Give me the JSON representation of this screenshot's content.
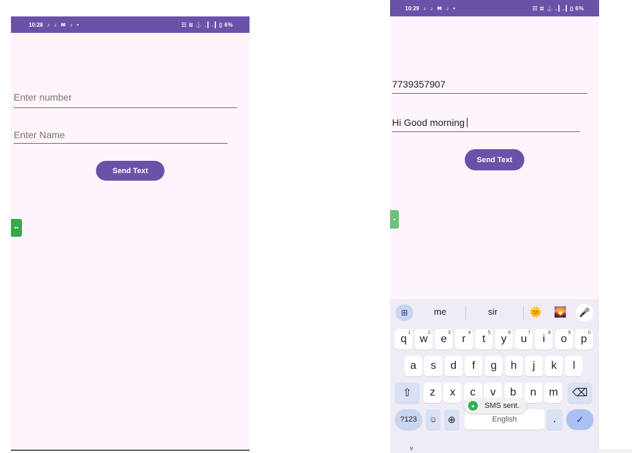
{
  "left_screen": {
    "status_time": "10:28",
    "status_icons": "♪ ♪ ✉ ♪ •",
    "status_right": "☷ ≣ ⚓ .┃ .┃ ▯ 6%",
    "number_placeholder": "Enter number",
    "name_placeholder": "Enter Name",
    "send_button": "Send Text",
    "tab_glyph": "••"
  },
  "right_screen": {
    "status_time": "10:29",
    "status_icons": "♪ ♪ ✉ ♪ •",
    "status_right": "☷ ≣ ⚓ .┃ .┃ ▯ 6%",
    "number_value": "7739357907",
    "message_value": "Hi Good morning",
    "send_button": "Send Text",
    "tab_glyph": "•"
  },
  "keyboard": {
    "suggestions": [
      "me",
      "sir"
    ],
    "emoji_1": "🌞",
    "emoji_2": "🌄",
    "row1": [
      {
        "k": "q",
        "n": "1"
      },
      {
        "k": "w",
        "n": "2"
      },
      {
        "k": "e",
        "n": "3"
      },
      {
        "k": "r",
        "n": "4"
      },
      {
        "k": "t",
        "n": "5"
      },
      {
        "k": "y",
        "n": "6"
      },
      {
        "k": "u",
        "n": "7"
      },
      {
        "k": "i",
        "n": "8"
      },
      {
        "k": "o",
        "n": "9"
      },
      {
        "k": "p",
        "n": "0"
      }
    ],
    "row2": [
      "a",
      "s",
      "d",
      "f",
      "g",
      "h",
      "j",
      "k",
      "l"
    ],
    "row3": [
      "z",
      "x",
      "c",
      "v",
      "b",
      "n",
      "m"
    ],
    "sym_key": "?123",
    "space_label": "English",
    "period_key": ".",
    "shift_icon": "⇧",
    "backspace_icon": "⌫",
    "enter_icon": "✓",
    "globe_icon": "⊕",
    "emoji_key": "☺",
    "toast": "SMS sent."
  }
}
